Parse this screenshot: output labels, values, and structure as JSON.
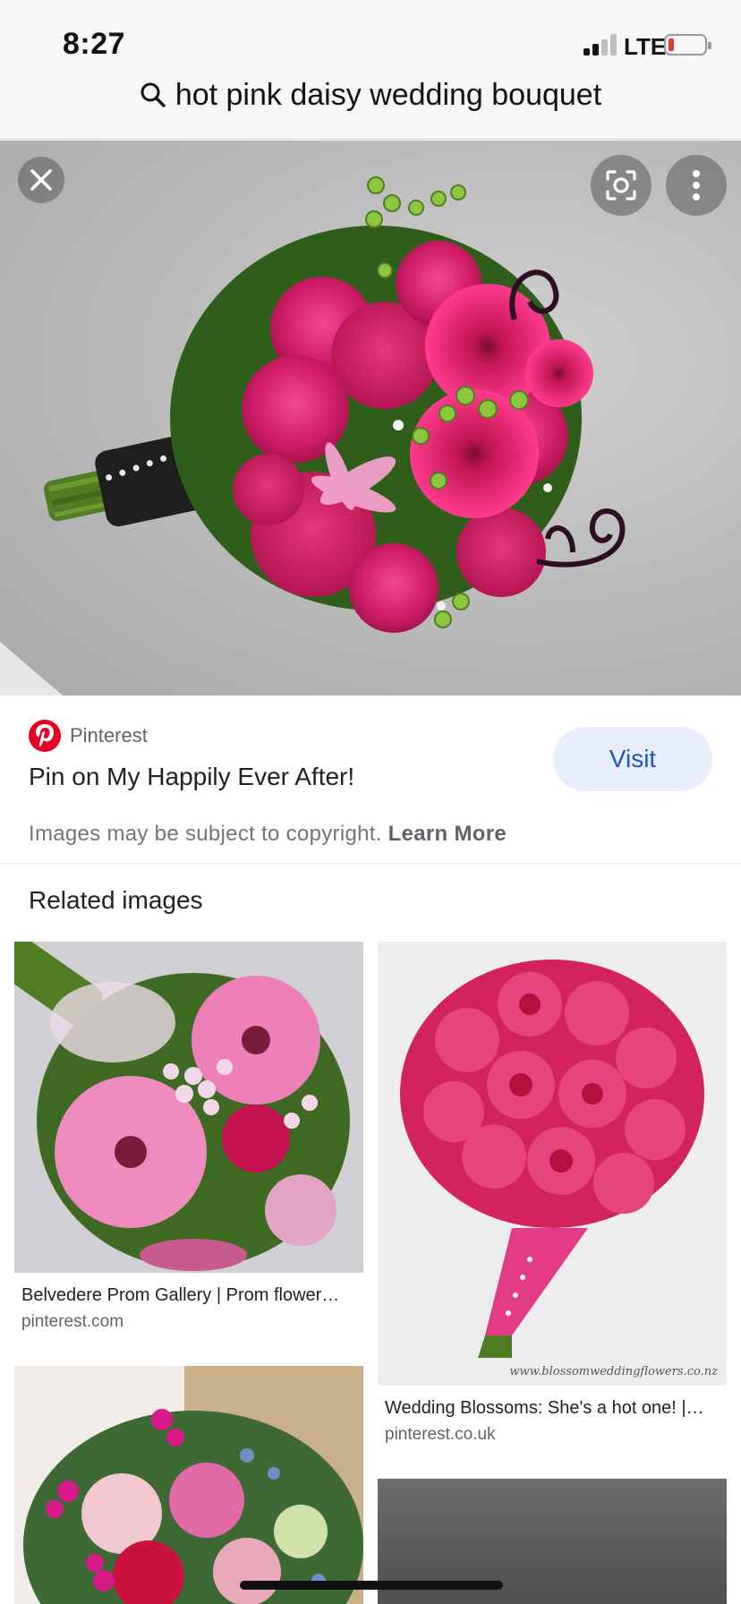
{
  "status_bar": {
    "time": "8:27",
    "network": "LTE"
  },
  "search": {
    "query": "hot pink daisy wedding bouquet"
  },
  "hero": {
    "close_icon": "close-icon",
    "lens_icon": "lens-icon",
    "more_icon": "more-vert-icon"
  },
  "source": {
    "site_name": "Pinterest",
    "pin_title": "Pin on My Happily Ever After!",
    "visit_label": "Visit",
    "copyright_text": "Images may be subject to copyright.",
    "learn_more_label": "Learn More"
  },
  "related": {
    "heading": "Related images",
    "items": [
      {
        "title": "Belvedere Prom Gallery | Prom flower…",
        "domain": "pinterest.com"
      },
      {
        "title": "Wedding Blossoms: She's a hot one! |…",
        "domain": "pinterest.co.uk",
        "watermark": "www.blossomweddingflowers.co.nz"
      },
      {
        "title": "",
        "domain": ""
      },
      {
        "title": "",
        "domain": ""
      }
    ]
  },
  "colors": {
    "accent_blue": "#1a56c7",
    "visit_bg": "#e8eefb",
    "pinterest_red": "#e60023"
  }
}
